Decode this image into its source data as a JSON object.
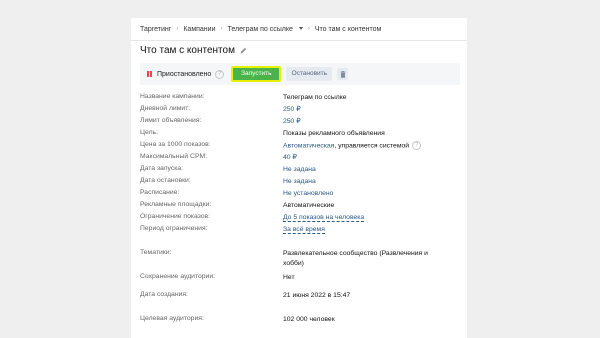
{
  "breadcrumb": [
    "Таргетинг",
    "Кампании",
    "Телеграм по ссылке",
    "Что там с контентом"
  ],
  "title": "Что там с контентом",
  "status": "Приостановлено",
  "buttons": {
    "start": "Запустить",
    "stop": "Остановить"
  },
  "help_glyph": "?",
  "fields": [
    {
      "label": "Название кампании:",
      "value": "Телеграм по ссылке",
      "style": "text"
    },
    {
      "label": "Дневной лимит:",
      "value": "250 ₽",
      "style": "link"
    },
    {
      "label": "Лимит объявления:",
      "value": "250 ₽",
      "style": "link"
    },
    {
      "label": "Цель:",
      "value": "Показы рекламного объявления",
      "style": "text"
    },
    {
      "label": "Цена за 1000 показов:",
      "value": "Автоматическая",
      "suffix": ", управляется системой",
      "style": "link-help"
    },
    {
      "label": "Максимальный CPM:",
      "value": "40 ₽",
      "style": "link"
    },
    {
      "label": "Дата запуска:",
      "value": "Не задана",
      "style": "link"
    },
    {
      "label": "Дата остановки:",
      "value": "Не задана",
      "style": "link"
    },
    {
      "label": "Расписание:",
      "value": "Не установлено",
      "style": "link"
    },
    {
      "label": "Рекламные площадки:",
      "value": "Автоматические",
      "style": "text"
    },
    {
      "label": "Ограничение показов:",
      "value": "До 5 показов на человека",
      "style": "dashed"
    },
    {
      "label": "Период ограничения:",
      "value": "За всё время",
      "style": "dashed"
    },
    {
      "label": "Тематики:",
      "value": "Развлекательное сообщество (Развлечения и хобби)",
      "style": "text"
    },
    {
      "label": "Сохранение аудитории:",
      "value": "Нет",
      "style": "text"
    },
    {
      "label": "Дата создания:",
      "value": "21 июня 2022 в 15:47",
      "style": "text"
    },
    {
      "label": "Целевая аудитория:",
      "value": "102 000 человек",
      "style": "text"
    }
  ],
  "colors": {
    "accent": "#4bb34b",
    "highlight": "#e6f000",
    "link": "#2a5885",
    "paused": "#e64646"
  }
}
